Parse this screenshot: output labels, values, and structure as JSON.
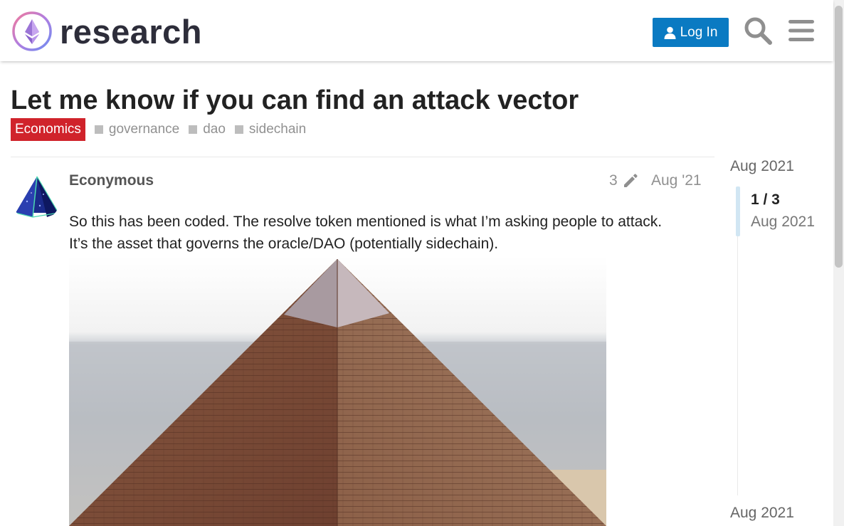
{
  "header": {
    "site_name": "research",
    "login_label": "Log In",
    "search_icon": "search-icon",
    "menu_icon": "hamburger-menu-icon",
    "accent_color": "#0a7ac2"
  },
  "topic": {
    "title": "Let me know if you can find an attack vector",
    "category": "Economics",
    "category_color": "#d0232b",
    "tags": [
      "governance",
      "dao",
      "sidechain"
    ]
  },
  "post": {
    "username": "Econymous",
    "edit_count": "3",
    "date": "Aug '21",
    "body": [
      "So this has been coded. The resolve token mentioned is what I’m asking people to attack.",
      "It’s the asset that governs the oracle/DAO (potentially sidechain)."
    ]
  },
  "timeline": {
    "top_date": "Aug 2021",
    "counter": "1 / 3",
    "current_date": "Aug 2021",
    "bottom_date": "Aug 2021"
  }
}
